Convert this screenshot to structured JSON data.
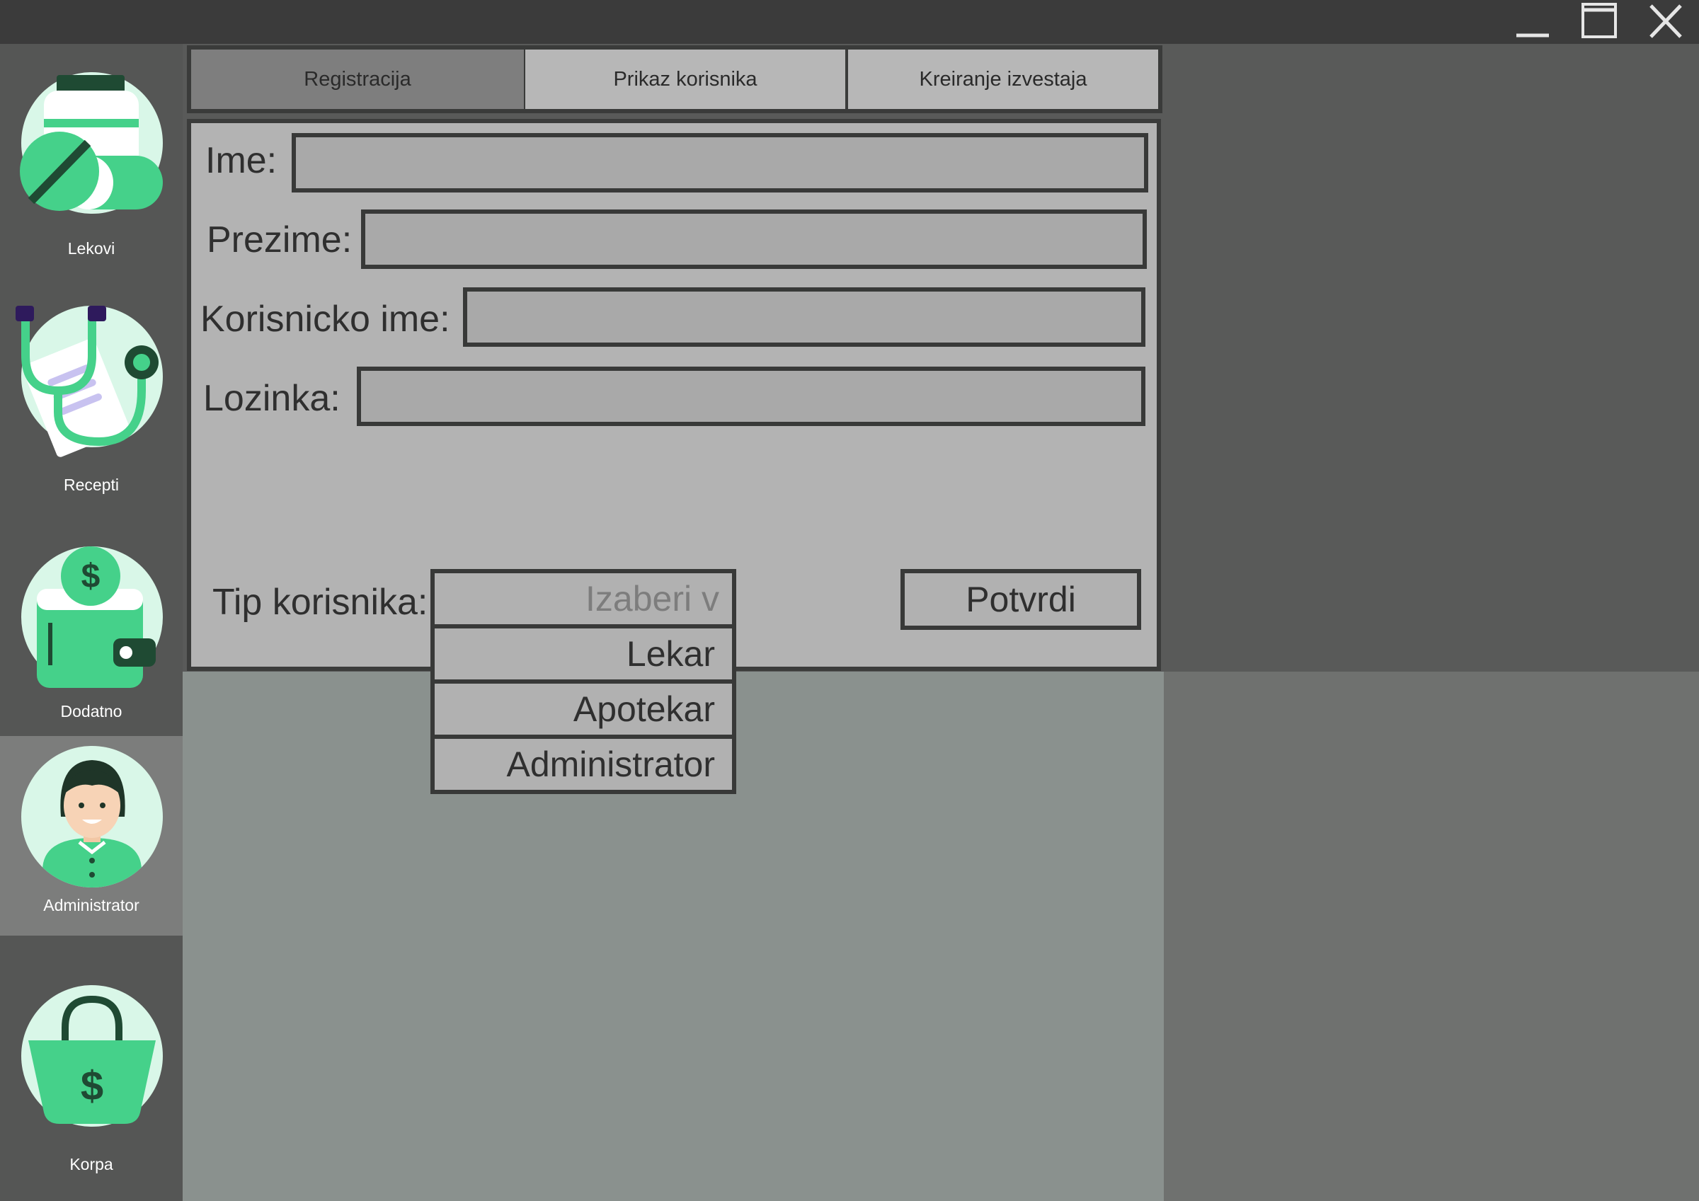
{
  "window": {
    "controls": {
      "minimize_icon": "minimize-icon",
      "maximize_icon": "maximize-icon",
      "close_icon": "close-icon"
    }
  },
  "sidebar": {
    "items": [
      {
        "label": "Lekovi",
        "icon": "medicine-icon",
        "active": false
      },
      {
        "label": "Recepti",
        "icon": "stethoscope-prescription-icon",
        "active": false
      },
      {
        "label": "Dodatno",
        "icon": "wallet-dollar-icon",
        "active": false
      },
      {
        "label": "Administrator",
        "icon": "user-avatar-icon",
        "active": true
      },
      {
        "label": "Korpa",
        "icon": "shopping-bag-icon",
        "active": false
      }
    ]
  },
  "tabs": [
    {
      "label": "Registracija",
      "active": true
    },
    {
      "label": "Prikaz korisnika",
      "active": false
    },
    {
      "label": "Kreiranje izvestaja",
      "active": false
    }
  ],
  "form": {
    "first_name": {
      "label": "Ime:",
      "value": ""
    },
    "last_name": {
      "label": "Prezime:",
      "value": ""
    },
    "username": {
      "label": "Korisnicko ime:",
      "value": ""
    },
    "password": {
      "label": "Lozinka:",
      "value": ""
    },
    "user_type": {
      "label": "Tip korisnika:",
      "placeholder": "Izaberi v",
      "options": [
        "Lekar",
        "Apotekar",
        "Administrator"
      ]
    },
    "submit_label": "Potvrdi"
  },
  "colors": {
    "accent_green": "#45d18a",
    "dark_green": "#1f4a33",
    "mint": "#d9f7e8",
    "titlebar": "#3b3b3b",
    "sidebar": "#555655"
  }
}
